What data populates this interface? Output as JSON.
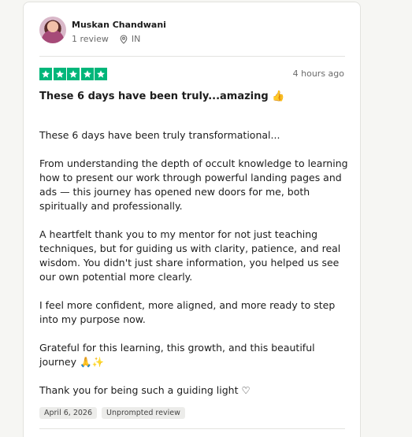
{
  "review": {
    "reviewer_name": "Muskan Chandwani",
    "review_count": "1 review",
    "location": "IN",
    "rating": 5,
    "time_ago": "4 hours ago",
    "title": "These 6 days have been truly...amazing 👍",
    "paragraphs": [
      "These 6 days have been truly transformational...",
      "From understanding the depth of occult knowledge to learning how to present our work through powerful landing pages and ads — this journey has opened new doors for me, both spiritually and professionally.",
      "A heartfelt thank you to my mentor for not just teaching techniques, but for guiding us with clarity, patience, and real wisdom. You didn't just share information, you helped us see our own potential more clearly.",
      "I feel more confident, more aligned, and more ready to step into my purpose now.",
      "Grateful for this learning, this growth, and this beautiful journey 🙏✨",
      "Thank you for being such a guiding light ♡"
    ],
    "date": "April 6, 2026",
    "tag": "Unprompted review"
  },
  "colors": {
    "star_green": "#00b67a",
    "meta_gray": "#6b6b6b"
  },
  "icons": {
    "location": "location-pin-icon",
    "star": "star-icon"
  }
}
